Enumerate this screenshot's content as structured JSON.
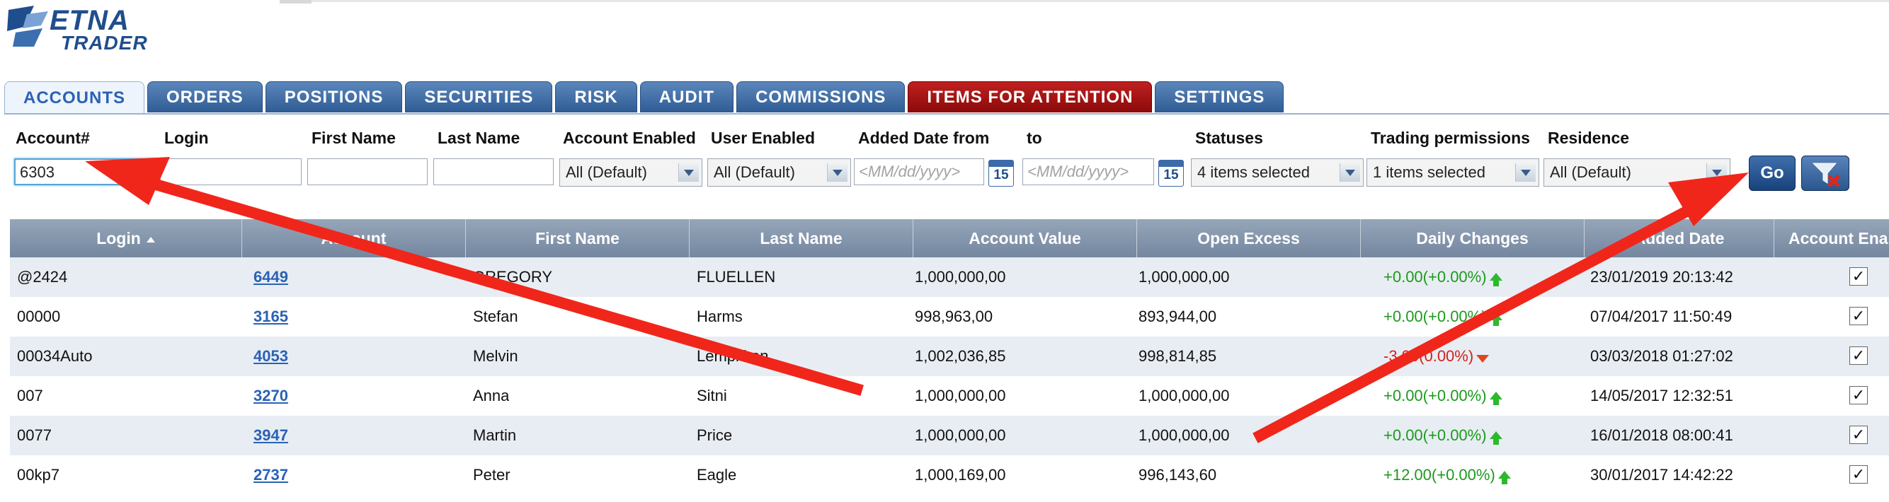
{
  "app": {
    "logo_line1": "ETNA",
    "logo_line2": "TRADER"
  },
  "tabs": [
    {
      "label": "ACCOUNTS",
      "active": true
    },
    {
      "label": "ORDERS"
    },
    {
      "label": "POSITIONS"
    },
    {
      "label": "SECURITIES"
    },
    {
      "label": "RISK"
    },
    {
      "label": "AUDIT"
    },
    {
      "label": "COMMISSIONS"
    },
    {
      "label": "ITEMS FOR ATTENTION",
      "highlight": true
    },
    {
      "label": "SETTINGS"
    }
  ],
  "filters": {
    "account_label": "Account#",
    "account_value": "6303",
    "login_label": "Login",
    "login_value": "",
    "first_name_label": "First Name",
    "first_name_value": "",
    "last_name_label": "Last Name",
    "last_name_value": "",
    "account_enabled_label": "Account Enabled",
    "account_enabled_value": "All (Default)",
    "user_enabled_label": "User Enabled",
    "user_enabled_value": "All (Default)",
    "added_from_label": "Added Date from",
    "added_from_placeholder": "<MM/dd/yyyy>",
    "to_label": "to",
    "added_to_placeholder": "<MM/dd/yyyy>",
    "calendar_day": "15",
    "statuses_label": "Statuses",
    "statuses_value": "4 items selected",
    "trading_permissions_label": "Trading permissions",
    "trading_permissions_value": "1 items selected",
    "residence_label": "Residence",
    "residence_value": "All (Default)",
    "go_label": "Go"
  },
  "table": {
    "columns": [
      "Login",
      "Account",
      "First Name",
      "Last Name",
      "Account Value",
      "Open Excess",
      "Daily Changes",
      "Added Date",
      "Account Enabled"
    ],
    "rows": [
      {
        "login": "@2424",
        "account": "6449",
        "first": "GREGORY",
        "last": "FLUELLEN",
        "value": "1,000,000,00",
        "excess": "1,000,000,00",
        "change": "+0.00(+0.00%)",
        "dir": "up",
        "added": "23/01/2019 20:13:42",
        "enabled": "✓"
      },
      {
        "login": "00000",
        "account": "3165",
        "first": "Stefan",
        "last": "Harms",
        "value": "998,963,00",
        "excess": "893,944,00",
        "change": "+0.00(+0.00%)",
        "dir": "up",
        "added": "07/04/2017 11:50:49",
        "enabled": "✓"
      },
      {
        "login": "00034Auto",
        "account": "4053",
        "first": "Melvin",
        "last": "Lempkkon",
        "value": "1,002,036,85",
        "excess": "998,814,85",
        "change": "-3.00(0.00%)",
        "dir": "down",
        "added": "03/03/2018 01:27:02",
        "enabled": "✓"
      },
      {
        "login": "007",
        "account": "3270",
        "first": "Anna",
        "last": "Sitni",
        "value": "1,000,000,00",
        "excess": "1,000,000,00",
        "change": "+0.00(+0.00%)",
        "dir": "up",
        "added": "14/05/2017 12:32:51",
        "enabled": "✓"
      },
      {
        "login": "0077",
        "account": "3947",
        "first": "Martin",
        "last": "Price",
        "value": "1,000,000,00",
        "excess": "1,000,000,00",
        "change": "+0.00(+0.00%)",
        "dir": "up",
        "added": "16/01/2018 08:00:41",
        "enabled": "✓"
      },
      {
        "login": "00kp7",
        "account": "2737",
        "first": "Peter",
        "last": "Eagle",
        "value": "1,000,169,00",
        "excess": "996,143,60",
        "change": "+12.00(+0.00%)",
        "dir": "up",
        "added": "30/01/2017 14:42:22",
        "enabled": "✓"
      }
    ]
  },
  "colors": {
    "tab_blue": "#2f5c95",
    "attention_red": "#8a0a0a",
    "arrow_red": "#f0261b",
    "positive": "#1c9a1c",
    "negative": "#d3221a"
  }
}
